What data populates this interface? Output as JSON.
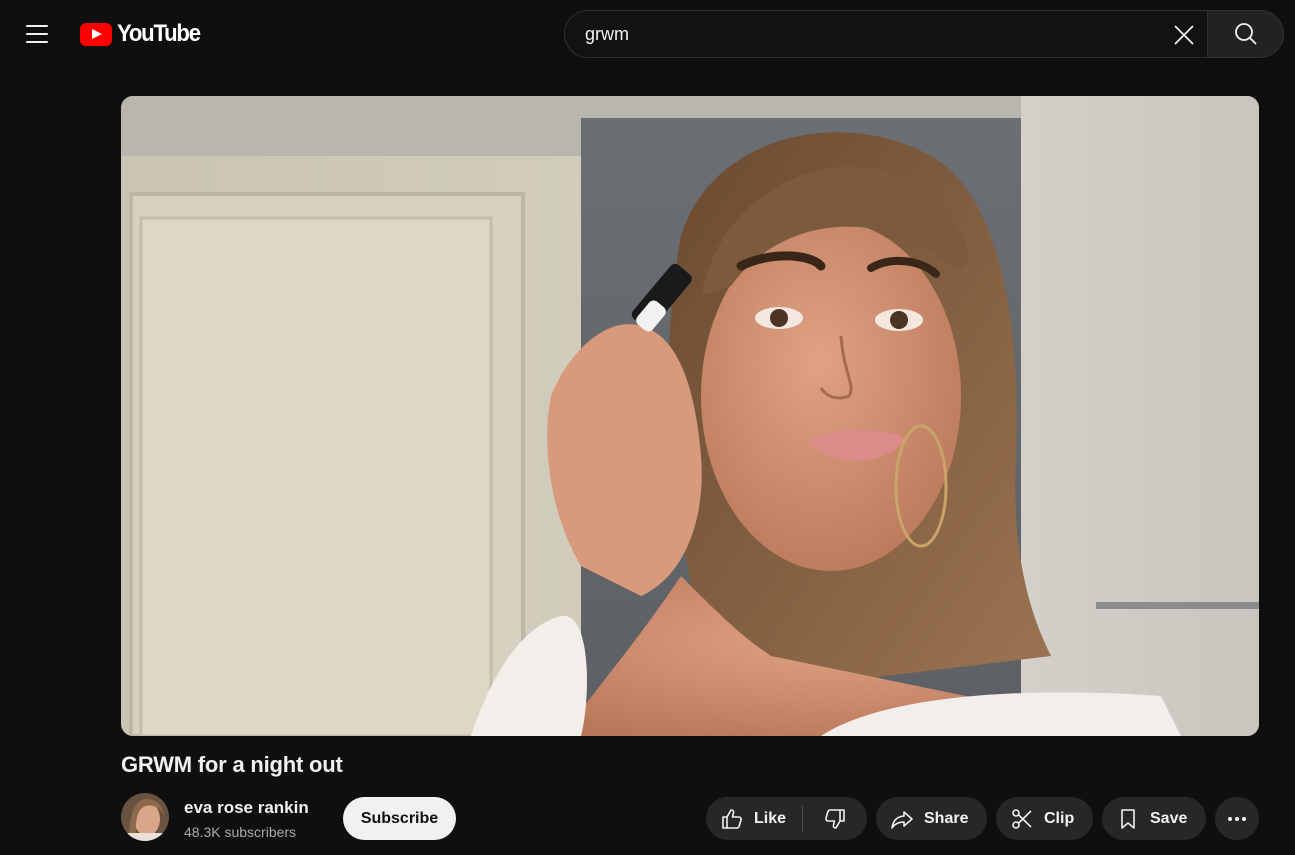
{
  "header": {
    "logo_text": "YouTube",
    "search_value": "grwm",
    "brand_color": "#ff0000"
  },
  "video": {
    "title": "GRWM for a night out"
  },
  "channel": {
    "name": "eva rose rankin",
    "subscribers": "48.3K subscribers",
    "subscribe_label": "Subscribe"
  },
  "actions": {
    "like_label": "Like",
    "share_label": "Share",
    "clip_label": "Clip",
    "save_label": "Save"
  },
  "icons": [
    "menu-icon",
    "youtube-logo-icon",
    "clear-icon",
    "search-icon",
    "thumbs-up-icon",
    "thumbs-down-icon",
    "share-icon",
    "scissors-icon",
    "bookmark-icon",
    "more-icon"
  ]
}
